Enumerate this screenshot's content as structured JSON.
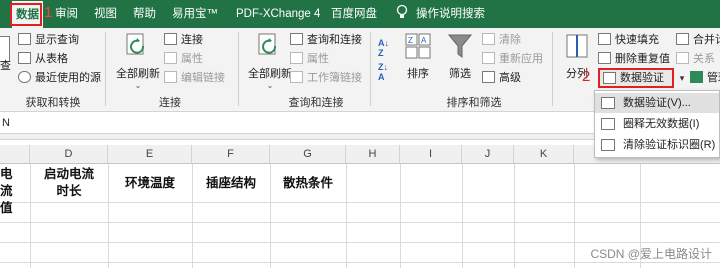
{
  "tabs": {
    "data": "数据",
    "review": "审阅",
    "view": "视图",
    "help": "帮助",
    "yiyongbao": "易用宝™",
    "pdfxchange": "PDF-XChange 4",
    "baidu": "百度网盘",
    "tellme": "操作说明搜索"
  },
  "annotations": {
    "one": "1",
    "two": "2"
  },
  "groups": {
    "get_transform": {
      "label": "获取和转换",
      "items": [
        "显示查询",
        "从表格",
        "最近使用的源"
      ],
      "partial": "查"
    },
    "connections": {
      "label": "连接",
      "refresh_all": "全部刷新",
      "items": [
        "连接",
        "属性",
        "编辑链接"
      ]
    },
    "queries": {
      "label": "查询和连接",
      "refresh_all": "全部刷新",
      "items": [
        "查询和连接",
        "属性",
        "工作簿链接"
      ]
    },
    "sort_filter": {
      "label": "排序和筛选",
      "sort": "排序",
      "filter": "筛选",
      "items": [
        "清除",
        "重新应用",
        "高级"
      ]
    },
    "data_tools": {
      "split": "分列",
      "items": [
        "快速填充",
        "删除重复值"
      ],
      "partial_merge": "合并计",
      "partial_relation": "关系",
      "data_validation": "数据验证",
      "manage_partial": "管理数"
    }
  },
  "dropdown": {
    "items": [
      "数据验证(V)...",
      "圈释无效数据(I)",
      "清除验证标识圈(R)"
    ]
  },
  "formula_bar": {
    "name_box": "N"
  },
  "grid": {
    "columns": [
      "D",
      "E",
      "F",
      "G",
      "H",
      "I",
      "J",
      "K"
    ],
    "headers": {
      "c_partial_line1": "电流",
      "c_partial_line2": "值",
      "d_line1": "启动电流",
      "d_line2": "时长",
      "e": "环境温度",
      "f": "插座结构",
      "g": "散热条件"
    }
  },
  "watermark": "CSDN @爱上电路设计",
  "colors": {
    "ribbon_green": "#217346",
    "annotation_red": "#e02020"
  }
}
